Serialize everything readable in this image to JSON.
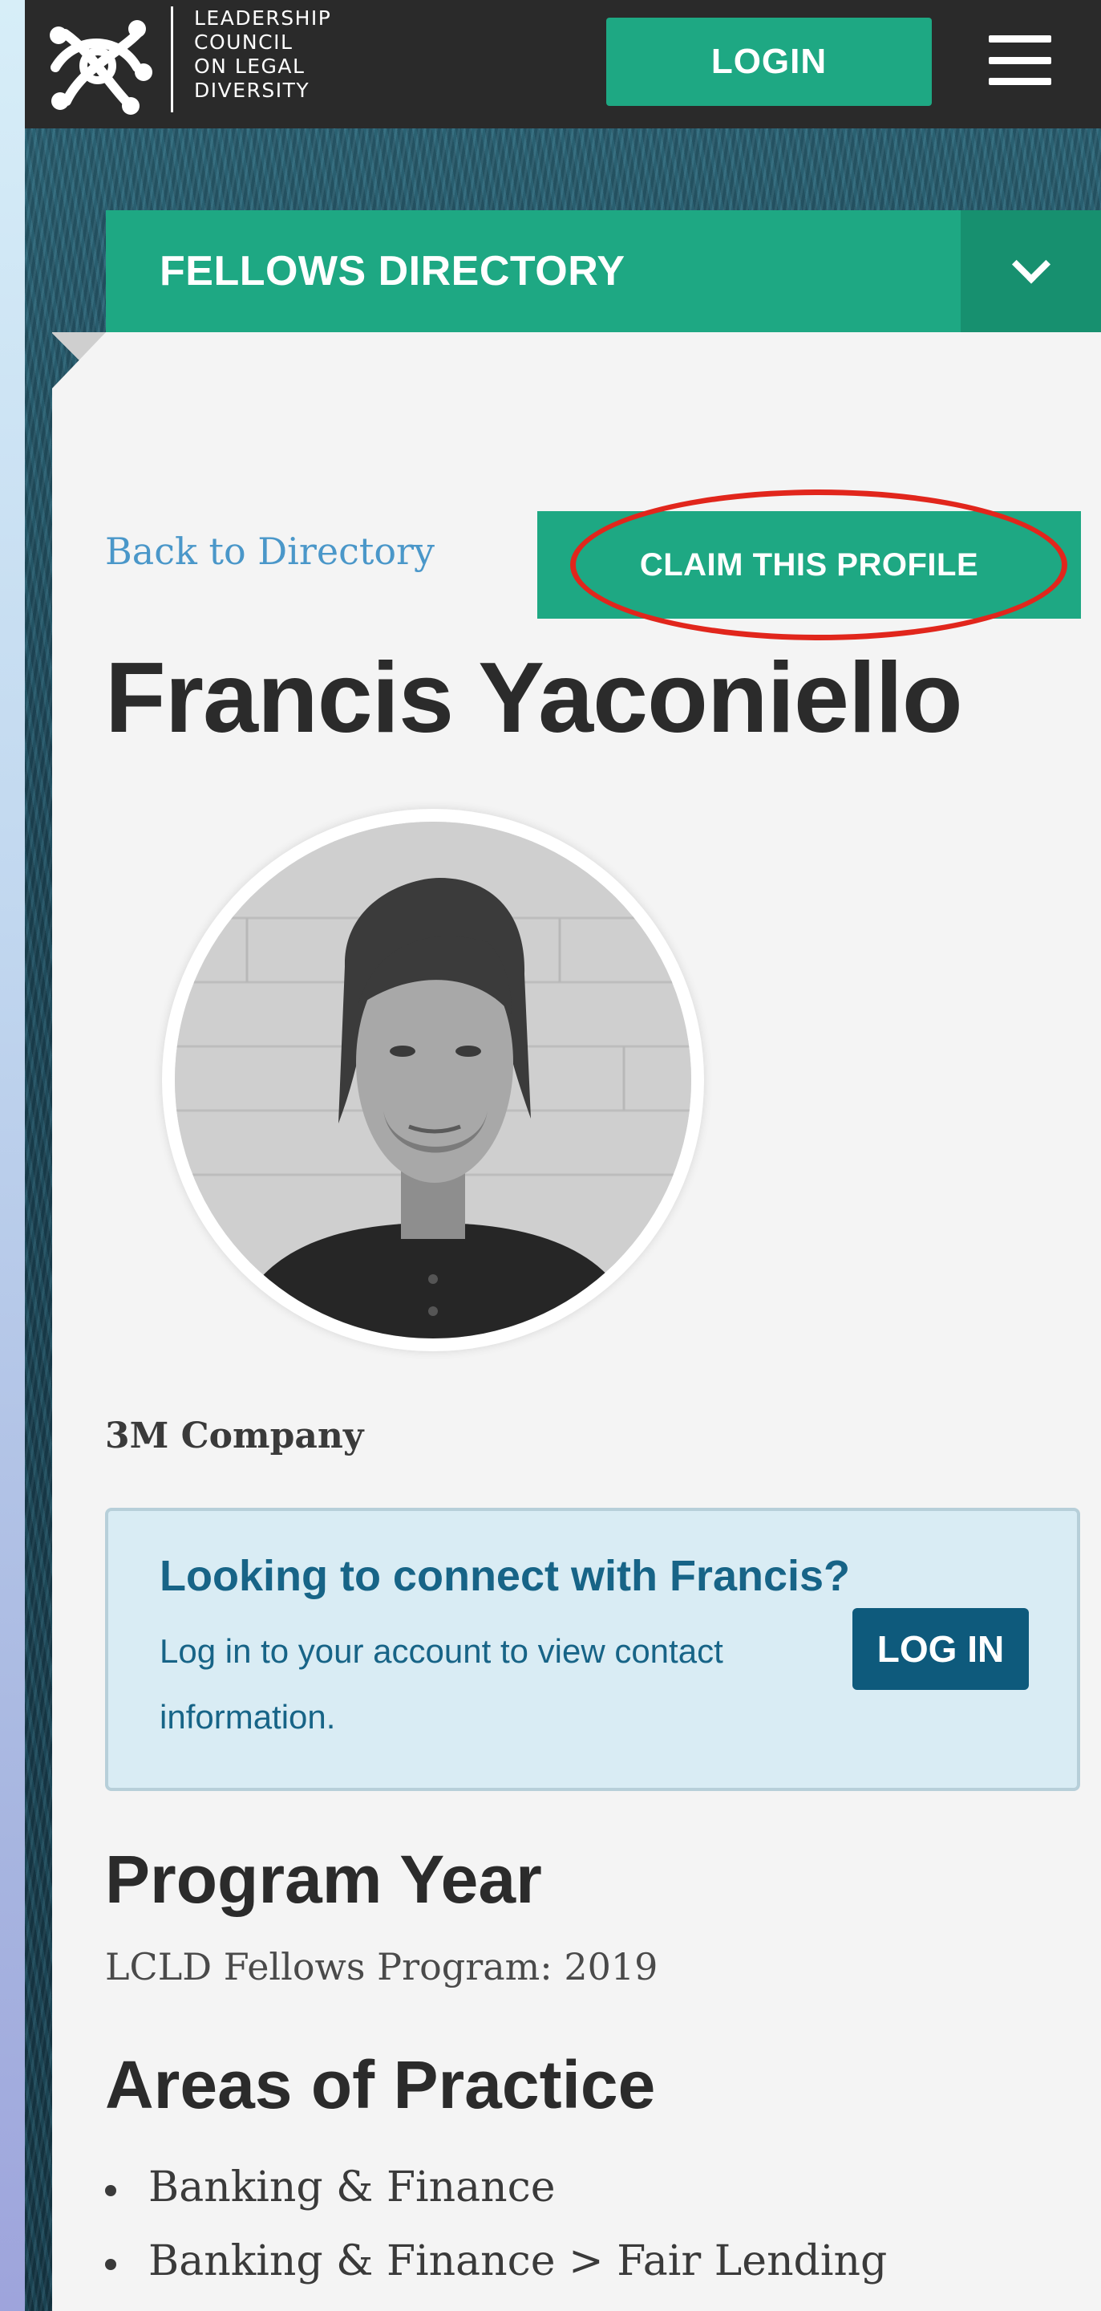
{
  "brand": {
    "name_lines": [
      "LEADERSHIP",
      "COUNCIL",
      "ON LEGAL",
      "DIVERSITY"
    ],
    "logo_icon": "lcld-logo-mark"
  },
  "header": {
    "login_label": "LOGIN",
    "menu_icon": "hamburger-menu-icon"
  },
  "directory_nav": {
    "title": "FELLOWS DIRECTORY",
    "toggle_icon": "chevron-down-icon"
  },
  "profile": {
    "back_link": "Back to Directory",
    "claim_label": "CLAIM THIS PROFILE",
    "name": "Francis Yaconiello",
    "company": "3M Company"
  },
  "connect": {
    "title": "Looking to connect with Francis?",
    "text": "Log in to your account to view contact information.",
    "login_label": "LOG IN"
  },
  "program_year": {
    "heading": "Program Year",
    "value": "LCLD Fellows Program: 2019"
  },
  "areas_of_practice": {
    "heading": "Areas of Practice",
    "items": [
      "Banking & Finance",
      "Banking & Finance > Fair Lending"
    ]
  },
  "colors": {
    "header_bg": "#2a2a2a",
    "green": "#1ea883",
    "green_dark": "#17906f",
    "connect_bg": "#d9ecf4",
    "connect_blue": "#176487",
    "link_blue": "#4a97c9",
    "highlight_red": "#e1261c"
  }
}
